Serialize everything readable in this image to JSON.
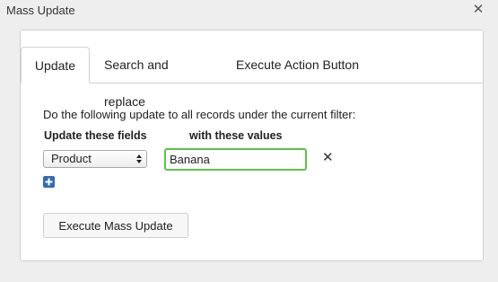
{
  "window": {
    "title": "Mass Update",
    "close_icon": "close-icon"
  },
  "tabs": [
    {
      "label": "Update",
      "active": true
    },
    {
      "label": "Search and replace",
      "active": false
    },
    {
      "label": "Execute Action Button",
      "active": false
    }
  ],
  "update_tab": {
    "description": "Do the following update to all records under the current filter:",
    "fields_header": "Update these fields",
    "values_header": "with these values",
    "rows": [
      {
        "field": "Product",
        "value": "Banana"
      }
    ],
    "add_icon": "plus-icon",
    "remove_icon": "remove-icon",
    "execute_label": "Execute Mass Update"
  },
  "colors": {
    "input_focus_border": "#5cc24a",
    "add_button": "#2f6cb1"
  }
}
